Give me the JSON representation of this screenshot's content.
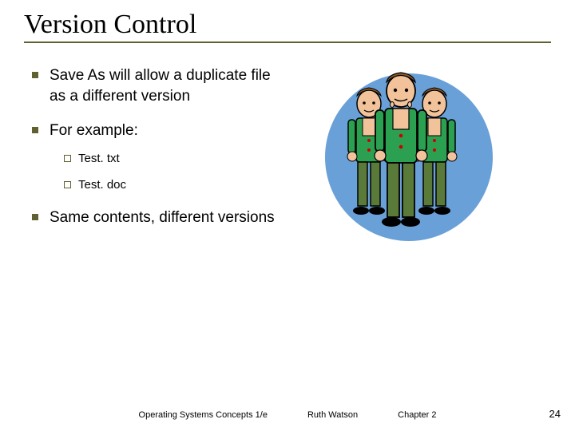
{
  "title": "Version Control",
  "bullets": {
    "b1": "Save As will allow a duplicate file as a different version",
    "b2": "For example:",
    "b2a": "Test. txt",
    "b2b": "Test. doc",
    "b3": "Same contents, different versions"
  },
  "footer": {
    "left": "Operating Systems Concepts 1/e",
    "center": "Ruth Watson",
    "right": "Chapter 2"
  },
  "page_number": "24"
}
